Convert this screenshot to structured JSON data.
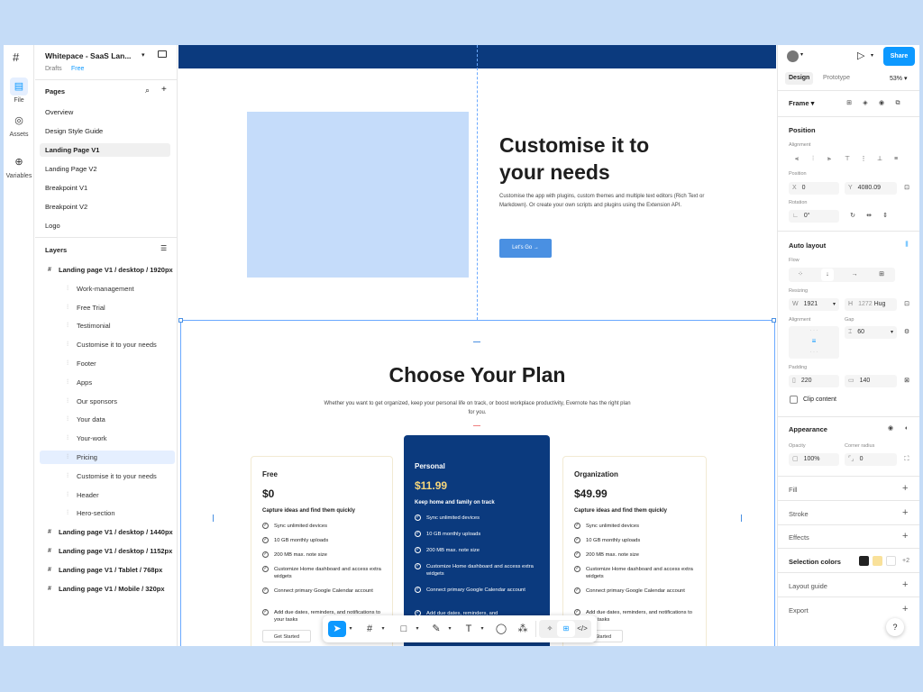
{
  "rail": {
    "logo": "#",
    "file": "File",
    "assets": "Assets",
    "variables": "Variables"
  },
  "file": {
    "title": "Whitepace - SaaS Lan...",
    "drafts": "Drafts",
    "plan": "Free"
  },
  "pages": {
    "heading": "Pages",
    "items": [
      "Overview",
      "Design Style Guide",
      "Landing Page V1",
      "Landing Page V2",
      "Breakpoint V1",
      "Breakpoint V2",
      "Logo"
    ]
  },
  "layers": {
    "heading": "Layers",
    "items": [
      {
        "label": "Landing page V1 / desktop / 1920px",
        "top": true
      },
      {
        "label": "Work-management"
      },
      {
        "label": "Free Trial"
      },
      {
        "label": "Testimonial"
      },
      {
        "label": "Customise it to your needs"
      },
      {
        "label": "Footer"
      },
      {
        "label": "Apps"
      },
      {
        "label": "Our sponsors"
      },
      {
        "label": "Your data"
      },
      {
        "label": "Your-work"
      },
      {
        "label": "Pricing",
        "selected": true
      },
      {
        "label": "Customise it to your needs"
      },
      {
        "label": "Header"
      },
      {
        "label": "Hero-section"
      },
      {
        "label": "Landing page V1 / desktop / 1440px",
        "top": true
      },
      {
        "label": "Landing page V1 / desktop / 1152px",
        "top": true
      },
      {
        "label": "Landing page V1 / Tablet / 768px",
        "top": true
      },
      {
        "label": "Landing page V1 / Mobile / 320px",
        "top": true
      }
    ]
  },
  "canvas": {
    "headline_line1": "Customise it to",
    "headline_line2": "your needs",
    "description": "Customise the app with plugins, custom themes and multiple text editors (Rich Text or Markdown). Or create your own scripts and plugins using the Extension API.",
    "cta": "Let's Go →",
    "pricing_title": "Choose Your Plan",
    "pricing_subtitle": "Whether you want to get organized, keep your personal life on track, or boost workplace productivity, Evernote has the right plan for you.",
    "plans": [
      {
        "name": "Free",
        "price": "$0",
        "tagline": "Capture ideas and find them quickly",
        "features": [
          "Sync unlimited devices",
          "10 GB monthly uploads",
          "200 MB max. note size",
          "Customize Home dashboard and access extra widgets",
          "Connect primary Google Calendar account",
          "Add due dates, reminders, and notifications to your tasks"
        ],
        "button": "Get Started"
      },
      {
        "name": "Personal",
        "price": "$11.99",
        "tagline": "Keep home and family on track",
        "features": [
          "Sync unlimited devices",
          "10 GB monthly uploads",
          "200 MB max. note size",
          "Customize Home dashboard and access extra widgets",
          "Connect primary Google Calendar account",
          "Add due dates, reminders, and"
        ],
        "button": ""
      },
      {
        "name": "Organization",
        "price": "$49.99",
        "tagline": "Capture ideas and find them quickly",
        "features": [
          "Sync unlimited devices",
          "10 GB monthly uploads",
          "200 MB max. note size",
          "Customize Home dashboard and access extra widgets",
          "Connect primary Google Calendar account",
          "Add due dates, reminders, and notifications to your tasks"
        ],
        "button": "Get Started"
      }
    ]
  },
  "toolbar": {
    "move": "➤",
    "frame": "#",
    "shape": "□",
    "pen": "✎",
    "text": "T",
    "comment": "◯",
    "actions": "⁂",
    "dev1": "✧",
    "dev2": "⊞",
    "dev3": "</>"
  },
  "right": {
    "share": "Share",
    "tab_design": "Design",
    "tab_prototype": "Prototype",
    "zoom": "53%",
    "frame": "Frame",
    "position": "Position",
    "alignment": "Alignment",
    "position_label": "Position",
    "x_label": "X",
    "x_value": "0",
    "y_label": "Y",
    "y_value": "4080.09",
    "rotation": "Rotation",
    "rotation_value": "0°",
    "auto_layout": "Auto layout",
    "flow": "Flow",
    "resizing": "Resizing",
    "w_label": "W",
    "w_value": "1921",
    "h_label": "H",
    "h_value": "1272",
    "h_mode": "Hug",
    "alignment2": "Alignment",
    "gap": "Gap",
    "gap_value": "60",
    "padding": "Padding",
    "pad_h": "220",
    "pad_v": "140",
    "clip": "Clip content",
    "appearance": "Appearance",
    "opacity": "Opacity",
    "opacity_value": "100%",
    "radius": "Corner radius",
    "radius_value": "0",
    "fill": "Fill",
    "stroke": "Stroke",
    "effects": "Effects",
    "selection_colors": "Selection colors",
    "more_colors": "+2",
    "layout_guide": "Layout guide",
    "export": "Export",
    "help": "?"
  },
  "colors": {
    "accent": "#0d99ff",
    "navy": "#0b3a7e",
    "highlight": "#fbe6a8",
    "swatch1": "#222222",
    "swatch2": "#f9e19a",
    "swatch3": "#ffffff"
  }
}
